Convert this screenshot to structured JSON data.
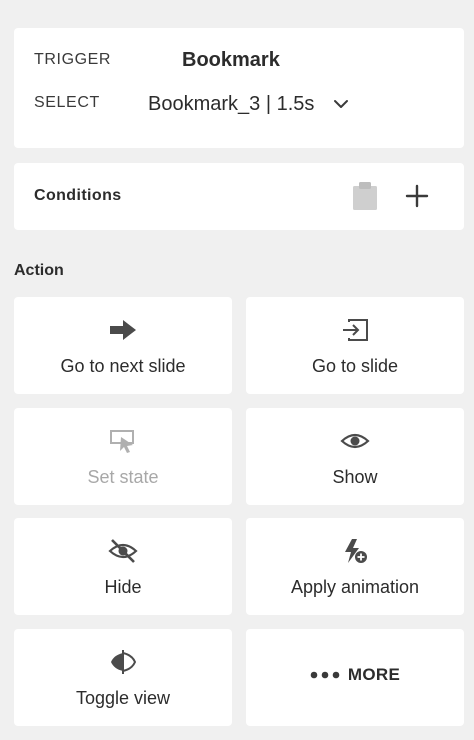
{
  "trigger": {
    "trigger_label": "TRIGGER",
    "trigger_value": "Bookmark",
    "select_label": "SELECT",
    "select_value": "Bookmark_3 | 1.5s"
  },
  "conditions": {
    "label": "Conditions",
    "icons": [
      "clipboard-icon",
      "plus-icon"
    ]
  },
  "action": {
    "heading": "Action",
    "tiles": [
      {
        "label": "Go to next slide",
        "icon": "arrow-right-icon",
        "enabled": true
      },
      {
        "label": "Go to slide",
        "icon": "slide-enter-icon",
        "enabled": true
      },
      {
        "label": "Set state",
        "icon": "set-state-icon",
        "enabled": false
      },
      {
        "label": "Show",
        "icon": "eye-icon",
        "enabled": true
      },
      {
        "label": "Hide",
        "icon": "eye-off-icon",
        "enabled": true
      },
      {
        "label": "Apply animation",
        "icon": "animation-add-icon",
        "enabled": true
      },
      {
        "label": "Toggle view",
        "icon": "toggle-view-icon",
        "enabled": true
      },
      {
        "label": "MORE",
        "icon": "more-dots-icon",
        "enabled": true
      }
    ]
  },
  "colors": {
    "background": "#f0f0f0",
    "card": "#ffffff",
    "text": "#2c2c2c",
    "disabled": "#a8a8a8",
    "icon": "#4b4b4b"
  }
}
